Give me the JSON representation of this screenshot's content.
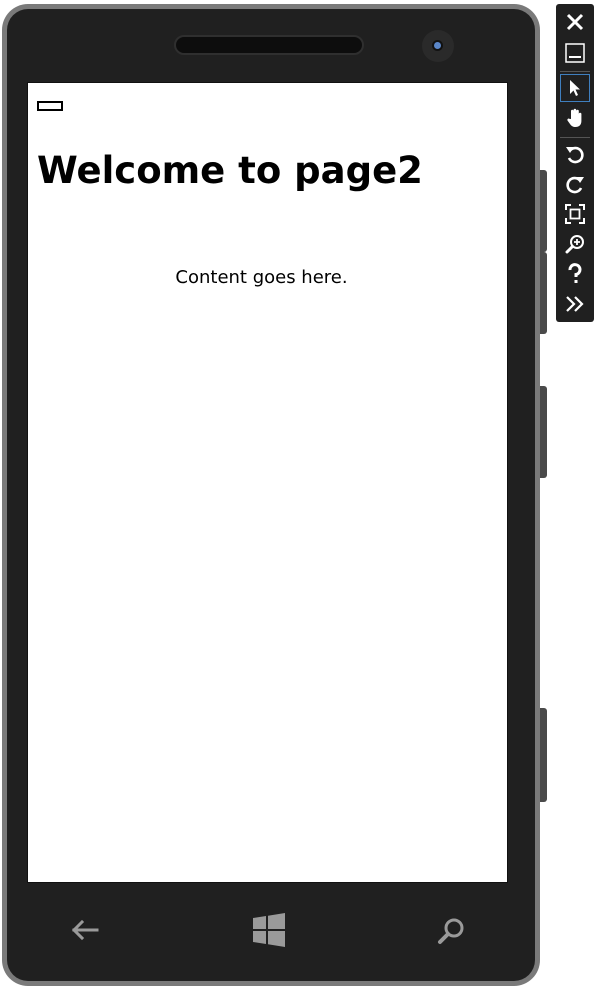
{
  "app": {
    "page_title": "Welcome to page2",
    "content_text": "Content goes here."
  },
  "phone": {
    "nav_buttons": [
      "back-icon",
      "windows-icon",
      "search-icon"
    ],
    "accent_color": "#202020"
  },
  "toolbar": {
    "buttons": [
      "close-icon",
      "minimize-icon",
      "pointer-icon",
      "hand-icon",
      "rotate-left-icon",
      "rotate-right-icon",
      "fit-screen-icon",
      "zoom-icon",
      "help-icon",
      "more-icon"
    ],
    "selected": "pointer-icon",
    "highlight_color": "#3f7fbf"
  }
}
